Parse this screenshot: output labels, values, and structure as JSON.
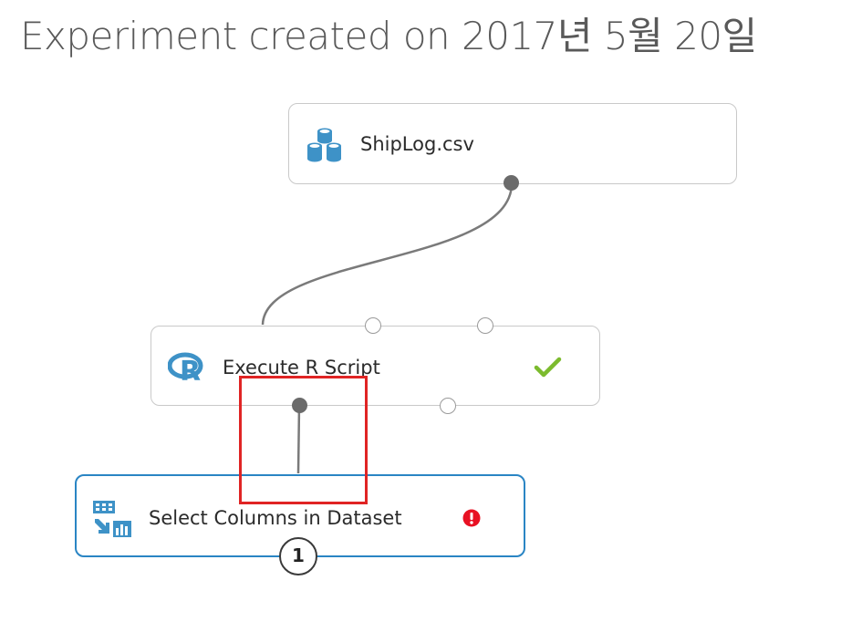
{
  "experiment": {
    "title": "Experiment created on 2017년 5월 20일"
  },
  "modules": {
    "shiplog": {
      "label": "ShipLog.csv",
      "icon": "dataset-cylinders-icon"
    },
    "execute_r": {
      "label": "Execute R Script",
      "icon": "r-logo-icon",
      "status": "check-icon"
    },
    "select_columns": {
      "label": "Select Columns in Dataset",
      "icon": "select-columns-icon",
      "status": "error-icon",
      "badge": "1"
    }
  },
  "colors": {
    "selected_border": "#2a85c4",
    "success": "#7cbb2e",
    "error": "#e81123",
    "highlight": "#e02424",
    "icon_blue": "#3e92c7"
  }
}
